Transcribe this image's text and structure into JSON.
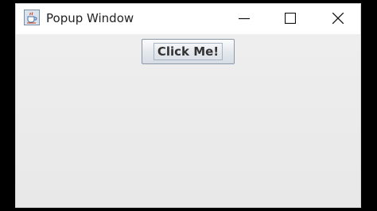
{
  "window": {
    "title": "Popup Window",
    "app_icon": "java-coffee-cup-icon",
    "controls": {
      "minimize": "minimize-icon",
      "maximize": "maximize-icon",
      "close": "close-icon"
    }
  },
  "content": {
    "button_label": "Click Me!"
  },
  "colors": {
    "titlebar_bg": "#ffffff",
    "client_bg": "#ececec",
    "desktop_bg": "#000000"
  }
}
